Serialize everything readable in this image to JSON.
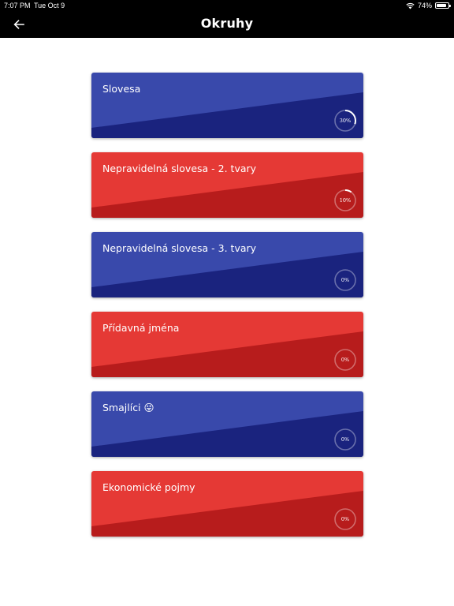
{
  "status_bar": {
    "time": "7:07 PM",
    "date": "Tue Oct 9",
    "battery": "74%",
    "battery_level": 0.74
  },
  "app_bar": {
    "title": "Okruhy",
    "back_icon": "arrow-left-icon"
  },
  "colors": {
    "blue_light": "#3949ab",
    "blue_dark": "#1a237e",
    "red_light": "#e53935",
    "red_dark": "#b71c1c"
  },
  "topics": [
    {
      "title": "Slovesa",
      "progress_label": "30%",
      "progress": 0.3,
      "color": "blue"
    },
    {
      "title": "Nepravidelná slovesa - 2. tvary",
      "progress_label": "10%",
      "progress": 0.1,
      "color": "red"
    },
    {
      "title": "Nepravidelná slovesa - 3. tvary",
      "progress_label": "0%",
      "progress": 0,
      "color": "blue"
    },
    {
      "title": "Přídavná jména",
      "progress_label": "0%",
      "progress": 0,
      "color": "red"
    },
    {
      "title": "Smajlíci 😜",
      "progress_label": "0%",
      "progress": 0,
      "color": "blue"
    },
    {
      "title": "Ekonomické pojmy",
      "progress_label": "0%",
      "progress": 0,
      "color": "red"
    }
  ]
}
